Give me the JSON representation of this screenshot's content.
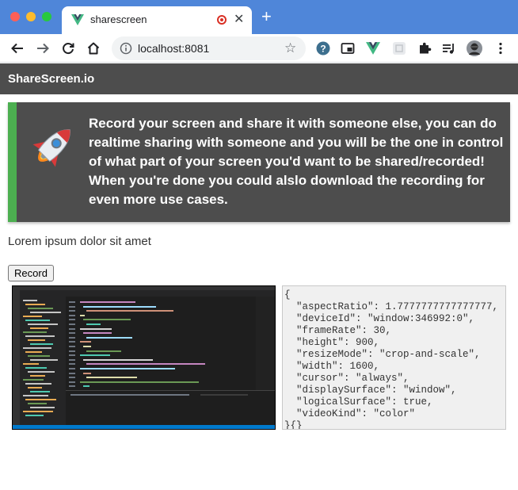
{
  "browser": {
    "tab_title": "sharescreen",
    "new_tab_label": "+",
    "close_tab_label": "✕",
    "url": "localhost:8081"
  },
  "app": {
    "brand": "ShareScreen.io",
    "hero_text": "Record your screen and share it with someone else, you can do realtime sharing with someone and you will be the one in control of what part of your screen you'd want to be shared/recorded! When you're done you could alslo download the recording for even more use cases.",
    "lorem": "Lorem ipsum dolor sit amet",
    "record_label": "Record"
  },
  "settings_json": "{\n  \"aspectRatio\": 1.7777777777777777,\n  \"deviceId\": \"window:346992:0\",\n  \"frameRate\": 30,\n  \"height\": 900,\n  \"resizeMode\": \"crop-and-scale\",\n  \"width\": 1600,\n  \"cursor\": \"always\",\n  \"displaySurface\": \"window\",\n  \"logicalSurface\": true,\n  \"videoKind\": \"color\"\n}{}",
  "colors": {
    "tabstrip": "#4f86d9",
    "app_header": "#4d4d4d",
    "hero_accent": "#4caf50",
    "vscode_status": "#007acc"
  },
  "icons": {
    "favicon": "vue-logo-icon",
    "recording": "recording-dot-icon",
    "back": "arrow-left-icon",
    "forward": "arrow-right-icon",
    "reload": "reload-icon",
    "home": "home-icon",
    "info": "info-icon",
    "bookmark": "star-icon",
    "extensions": [
      "help-extension-icon",
      "pip-extension-icon",
      "vue-devtools-icon",
      "grid-extension-icon",
      "puzzle-icon",
      "media-queue-icon",
      "profile-avatar-icon",
      "kebab-menu-icon"
    ],
    "hero": "rocket-icon"
  }
}
